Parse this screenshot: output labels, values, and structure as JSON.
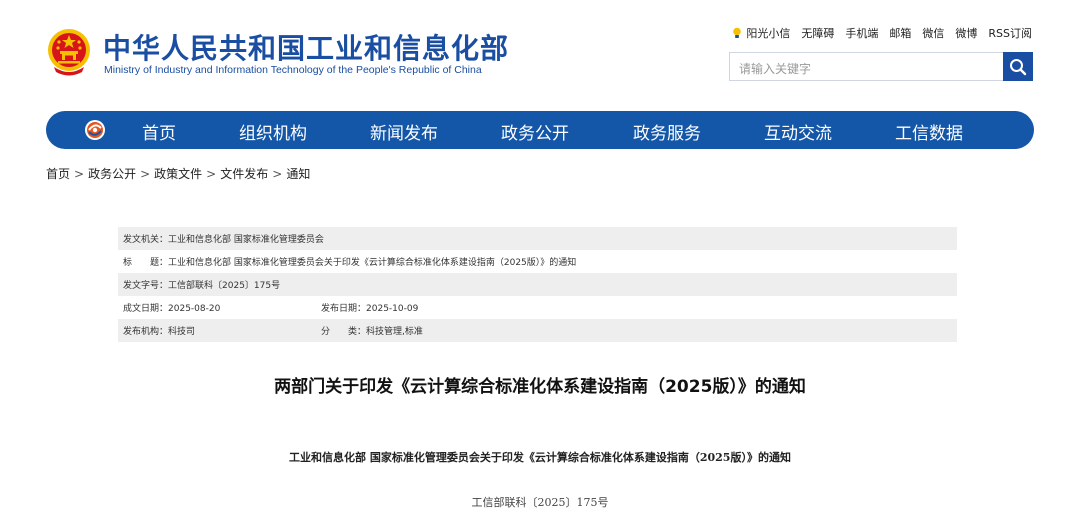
{
  "header": {
    "title": "中华人民共和国工业和信息化部",
    "subtitle": "Ministry of Industry and Information Technology of the People's Republic of China",
    "links": {
      "sunshine": "阳光小信",
      "accessibility": "无障碍",
      "mobile": "手机端",
      "mail": "邮箱",
      "wechat": "微信",
      "weibo": "微博",
      "rss": "RSS订阅"
    },
    "search": {
      "placeholder": "请输入关键字"
    }
  },
  "nav": {
    "items": [
      "首页",
      "组织机构",
      "新闻发布",
      "政务公开",
      "政务服务",
      "互动交流",
      "工信数据"
    ]
  },
  "breadcrumb": [
    "首页",
    "政务公开",
    "政策文件",
    "文件发布",
    "通知"
  ],
  "meta": {
    "issuer_label": "发文机关：",
    "issuer": "工业和信息化部 国家标准化管理委员会",
    "title_label": "标　　题：",
    "title": "工业和信息化部 国家标准化管理委员会关于印发《云计算综合标准化体系建设指南（2025版）》的通知",
    "doc_no_label": "发文字号：",
    "doc_no": "工信部联科〔2025〕175号",
    "written_label": "成文日期：",
    "written": "2025-08-20",
    "published_label": "发布日期：",
    "published": "2025-10-09",
    "org_label": "发布机构：",
    "org": "科技司",
    "category_label": "分　　类：",
    "category": "科技管理,标准"
  },
  "article": {
    "title": "两部门关于印发《云计算综合标准化体系建设指南（2025版）》的通知",
    "subtitle": "工业和信息化部 国家标准化管理委员会关于印发《云计算综合标准化体系建设指南（2025版）》的通知",
    "doc_number": "工信部联科〔2025〕175号"
  },
  "colors": {
    "brand_blue": "#1a4ea2",
    "nav_blue": "#1457a8",
    "emblem_red": "#d7141a",
    "emblem_gold": "#f6c000",
    "row_shade": "#eeeeee"
  }
}
